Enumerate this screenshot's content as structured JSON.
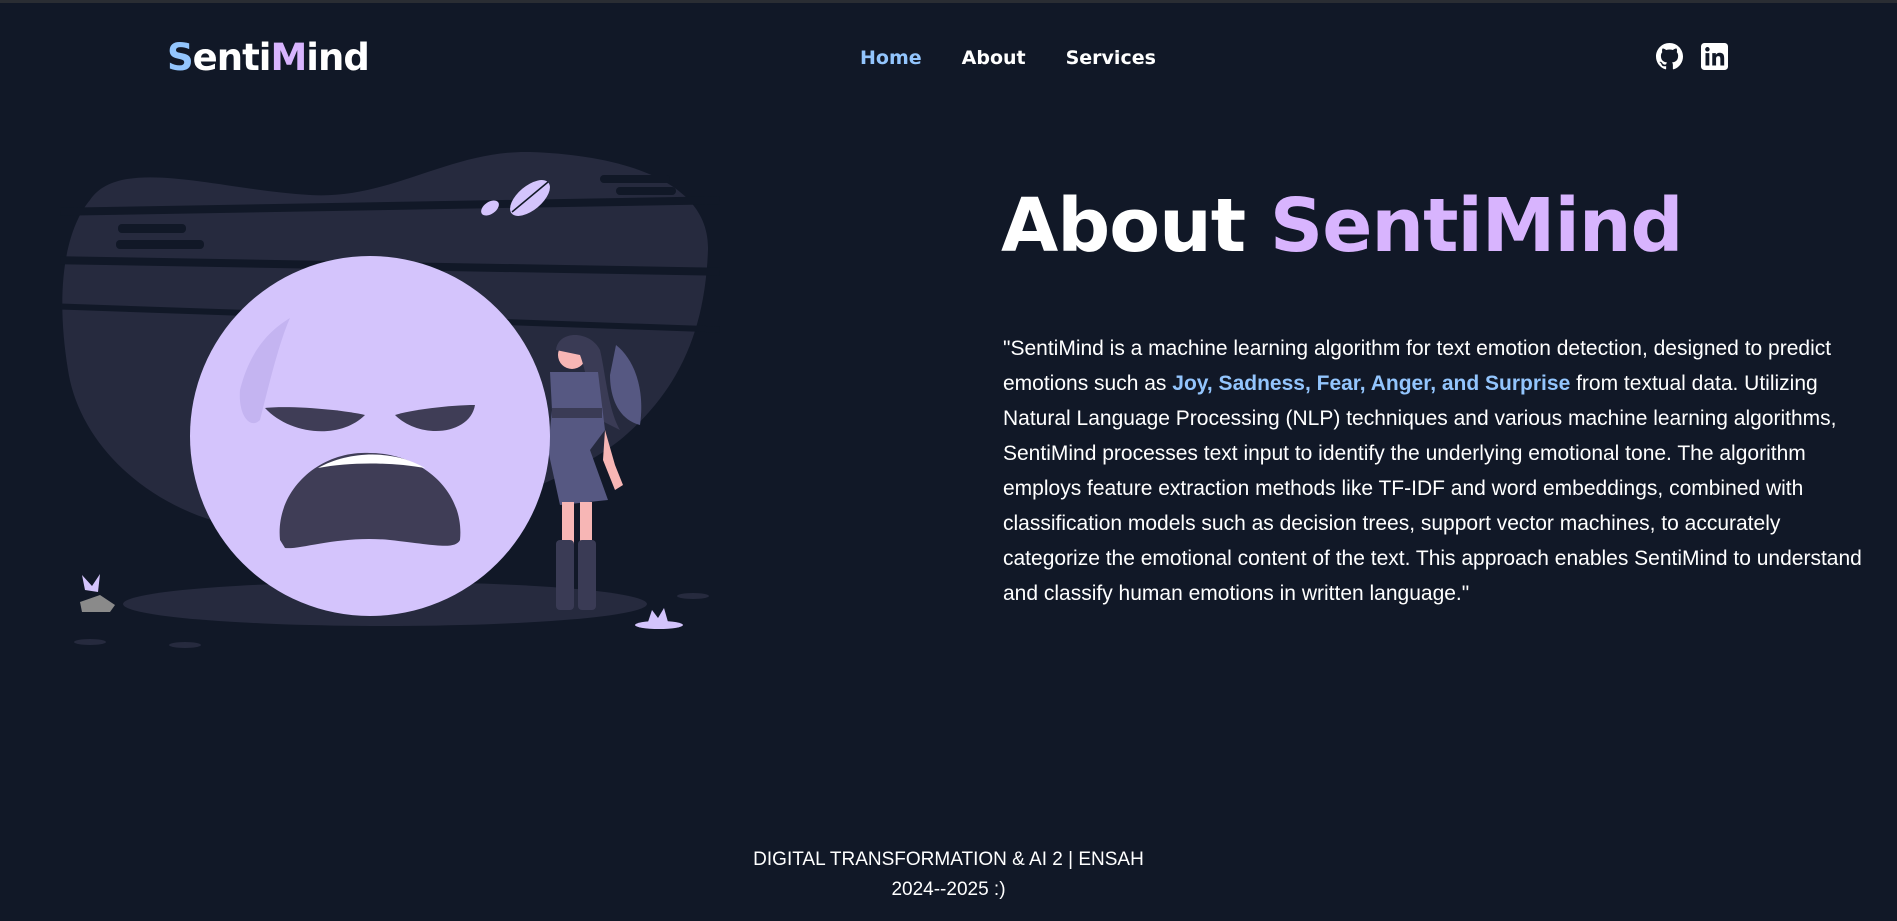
{
  "brand": {
    "part1": "S",
    "part2": "enti",
    "part3": "M",
    "part4": "ind"
  },
  "nav": {
    "items": [
      {
        "label": "Home",
        "active": true
      },
      {
        "label": "About",
        "active": false
      },
      {
        "label": "Services",
        "active": false
      }
    ]
  },
  "social": {
    "icons": [
      "github-icon",
      "linkedin-icon"
    ]
  },
  "about": {
    "title_prefix": "About ",
    "title_accent": "SentiMind",
    "text_part1": "\"SentiMind is a machine learning algorithm for text emotion detection, designed to predict emotions such as ",
    "text_highlight": "Joy, Sadness, Fear, Anger, and Surprise",
    "text_part2": " from textual data. Utilizing Natural Language Processing (NLP) techniques and various machine learning algorithms, SentiMind processes text input to identify the underlying emotional tone. The algorithm employs feature extraction methods like TF-IDF and word embeddings, combined with classification models such as decision trees, support vector machines, to accurately categorize the emotional content of the text. This approach enables SentiMind to understand and classify human emotions in written language.\""
  },
  "footer": {
    "line1": "DIGITAL TRANSFORMATION & AI 2 | ENSAH",
    "line2": "2024--2025 :)"
  },
  "colors": {
    "background": "#111827",
    "accent_blue": "#93c5fd",
    "accent_purple": "#d8b4fe",
    "face": "#d4c4fc"
  }
}
